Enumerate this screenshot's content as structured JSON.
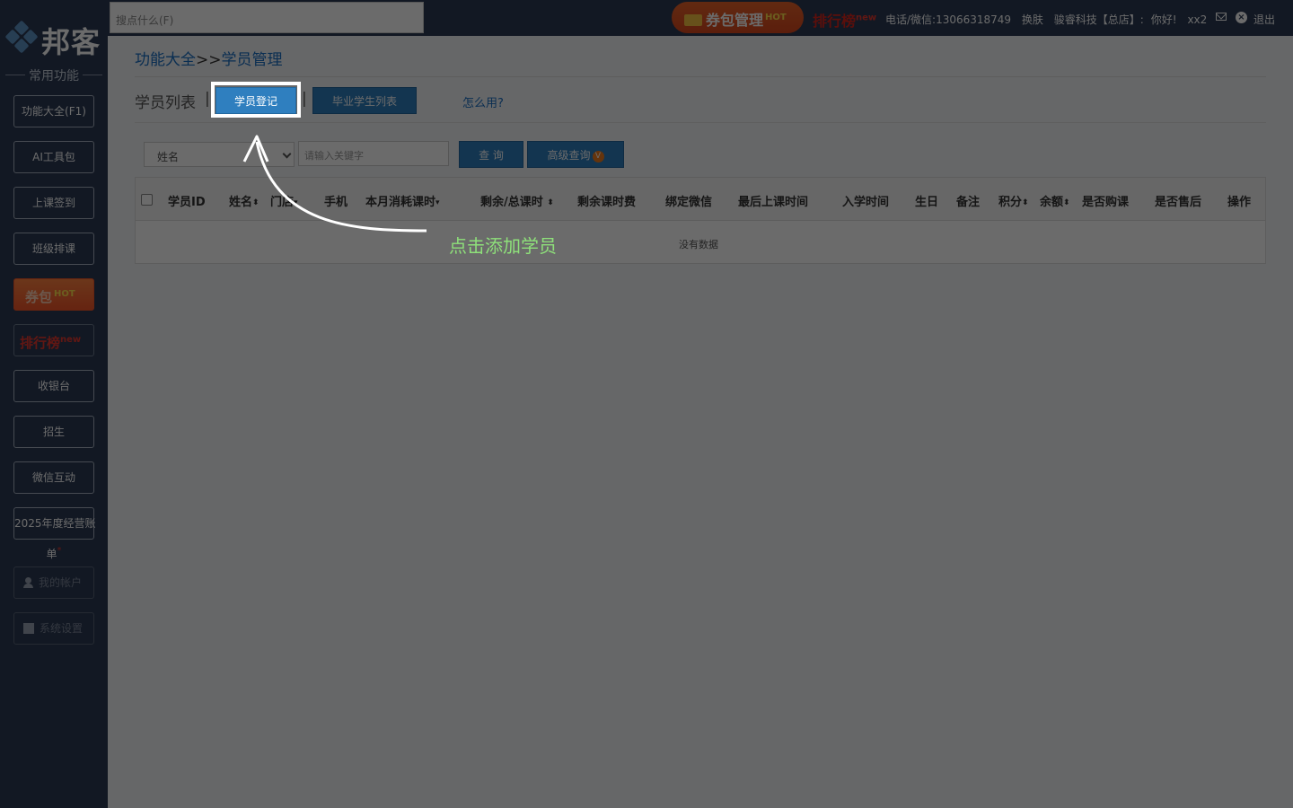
{
  "search": {
    "placeholder": "搜点什么(F)"
  },
  "topbar": {
    "coupon_label": "券包管理",
    "coupon_hot": "HOT",
    "rank_label": "排行榜",
    "rank_new": "new",
    "phone": "电话/微信:13066318749",
    "skin": "换肤",
    "org": "骏睿科技【总店】:",
    "greeting": "你好!",
    "user": "xx2",
    "logout": "退出"
  },
  "sidebar": {
    "logo": "邦客",
    "caption": "常用功能",
    "items": [
      {
        "label": "功能大全(F1)"
      },
      {
        "label": "AI工具包"
      },
      {
        "label": "上课签到"
      },
      {
        "label": "班级排课"
      },
      {
        "label": "券包",
        "hot": "HOT"
      },
      {
        "label": "排行榜",
        "new": "new"
      },
      {
        "label": "收银台"
      },
      {
        "label": "招生"
      },
      {
        "label": "微信互动"
      },
      {
        "label": "2025年度经营账",
        "label2": "单",
        "star": "*"
      },
      {
        "label": "我的帐户"
      },
      {
        "label": "系统设置"
      }
    ]
  },
  "breadcrumb": {
    "root": "功能大全",
    "sep": ">>",
    "current": "学员管理"
  },
  "tabs": {
    "title": "学员列表",
    "pipe": "|",
    "register": "学员登记",
    "graduated": "毕业学生列表",
    "help": "怎么用?"
  },
  "filter": {
    "field_selected": "姓名",
    "keyword_placeholder": "请输入关键字",
    "query": "查 询",
    "advanced": "高级查询",
    "advanced_badge": "V"
  },
  "table": {
    "columns": [
      "学员ID",
      "姓名",
      "门店",
      "手机",
      "本月消耗课时",
      "剩余/总课时",
      "剩余课时费",
      "绑定微信",
      "最后上课时间",
      "入学时间",
      "生日",
      "备注",
      "积分",
      "余额",
      "是否购课",
      "是否售后",
      "操作"
    ],
    "empty": "没有数据"
  },
  "guide": {
    "text": "点击添加学员"
  },
  "colors": {
    "accent": "#2f7fbf",
    "sidebar": "#2b3a55",
    "guide": "#8ee07a",
    "hot": "#f3562a"
  }
}
